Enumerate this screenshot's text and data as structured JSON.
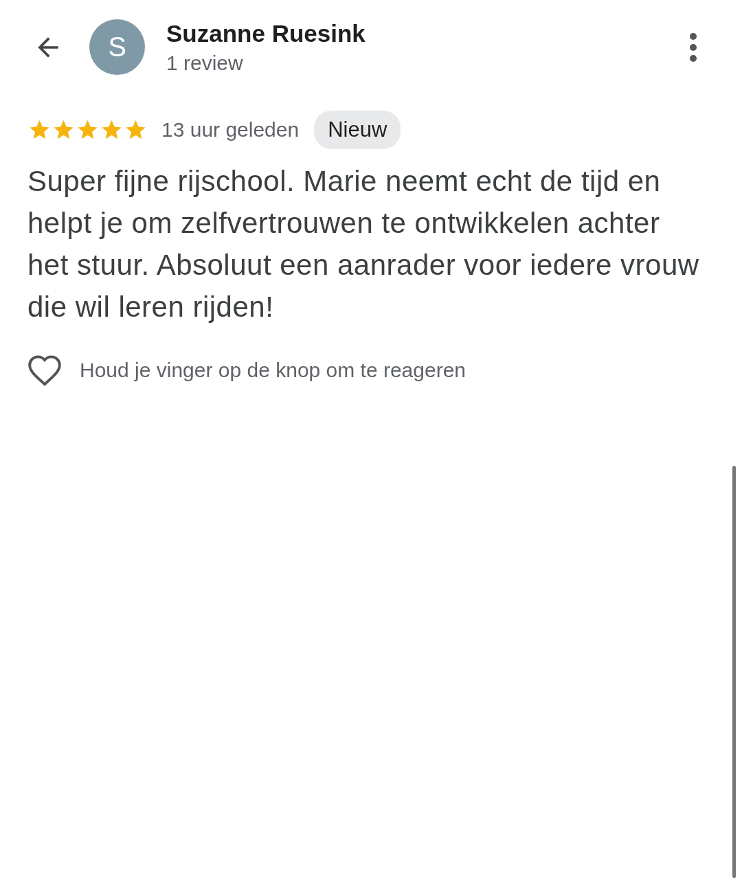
{
  "header": {
    "avatar_letter": "S",
    "name": "Suzanne Ruesink",
    "subtitle": "1 review"
  },
  "review": {
    "stars": 5,
    "time": "13 uur geleden",
    "badge": "Nieuw",
    "text": "Super fijne rijschool. Marie neemt echt de tijd en helpt je om zelfvertrouwen te ontwikkelen achter het stuur. Absoluut een aanrader voor iedere vrouw die wil leren rijden!"
  },
  "reaction": {
    "hint": "Houd je vinger op de knop om te reageren"
  }
}
